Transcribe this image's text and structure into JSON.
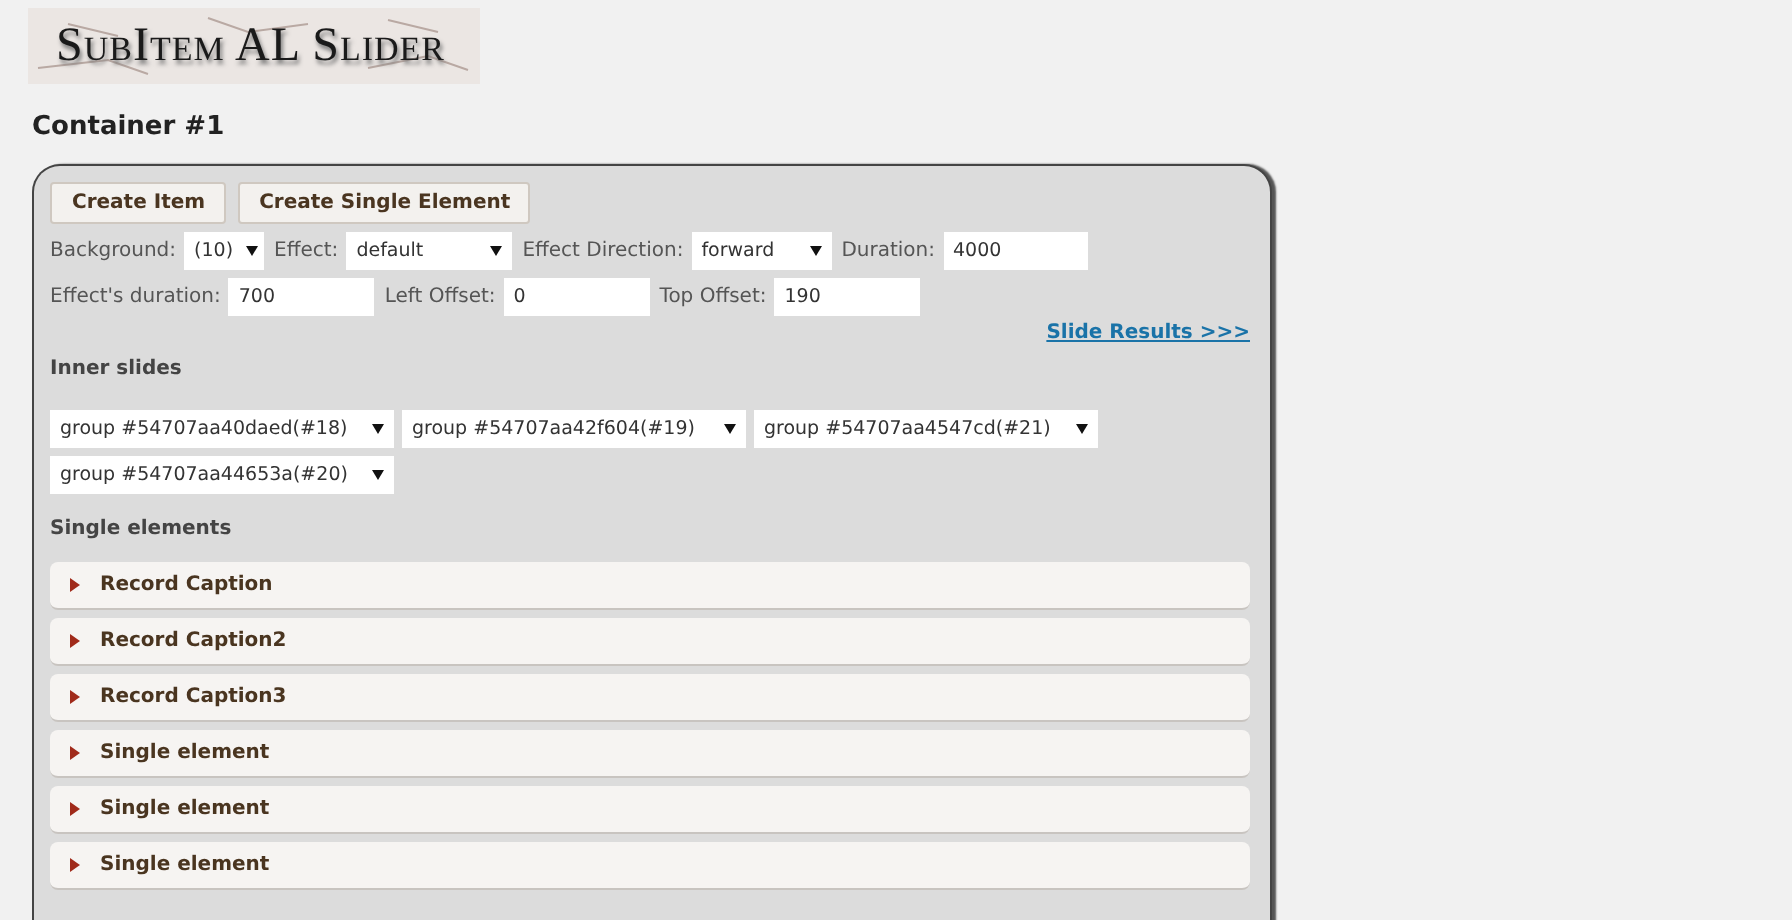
{
  "logo": {
    "title": "SubItem AL Slider"
  },
  "container": {
    "title": "Container #1",
    "buttons": [
      "Create Item",
      "Create Single Element"
    ],
    "field_rows": [
      [
        {
          "kind": "select",
          "label": "Background:",
          "value": "(10)"
        },
        {
          "kind": "select",
          "label": "Effect:",
          "value": "default"
        },
        {
          "kind": "select",
          "label": "Effect Direction:",
          "value": "forward"
        },
        {
          "kind": "input",
          "label": "Duration:",
          "value": "4000"
        }
      ],
      [
        {
          "kind": "input",
          "label": "Effect's duration:",
          "value": "700"
        },
        {
          "kind": "input",
          "label": "Left Offset:",
          "value": "0"
        },
        {
          "kind": "input",
          "label": "Top Offset:",
          "value": "190"
        }
      ]
    ],
    "link": "Slide Results >>>",
    "inner_slides": {
      "label": "Inner slides",
      "groups": [
        "group #54707aa40daed(#18)",
        "group #54707aa42f604(#19)",
        "group #54707aa4547cd(#21)",
        "group #54707aa44653a(#20)"
      ]
    },
    "single_elements": {
      "label": "Single elements",
      "items": [
        {
          "title": "Record Caption",
          "expanded": false
        },
        {
          "title": "Record Caption2",
          "expanded": false
        },
        {
          "title": "Record Caption3",
          "expanded": false
        },
        {
          "title": "Single element",
          "expanded": false
        },
        {
          "title": "Single element",
          "expanded": false
        },
        {
          "title": "Single element",
          "expanded": false
        }
      ]
    }
  }
}
